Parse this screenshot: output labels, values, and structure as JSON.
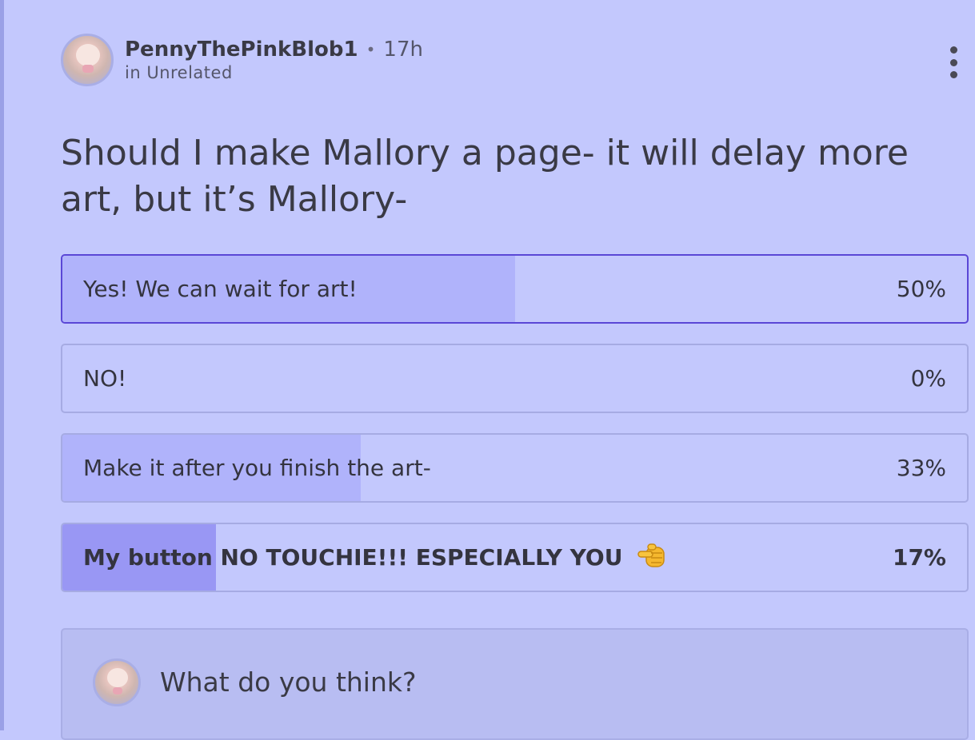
{
  "post": {
    "author": "PennyThePinkBlob1",
    "separator": "•",
    "time": "17h",
    "category": "in Unrelated",
    "title": "Should I make Mallory a page- it will delay more art, but it’s Mallory-"
  },
  "poll": {
    "options": [
      {
        "label": "Yes! We can wait for art!",
        "percent_label": "50%",
        "percent": 50
      },
      {
        "label": "NO!",
        "percent_label": "0%",
        "percent": 0
      },
      {
        "label": "Make it after you finish the art-",
        "percent_label": "33%",
        "percent": 33
      },
      {
        "label": "My button NO TOUCHIE!!! ESPECIALLY YOU",
        "percent_label": "17%",
        "percent": 17
      }
    ]
  },
  "comment": {
    "placeholder": "What do you think?"
  },
  "icons": {
    "more": "more-vertical-icon",
    "pointing": "pointing-fist-emoji-icon"
  },
  "colors": {
    "background": "#c3c8fd",
    "selected_border": "#5a47d6",
    "fill": "#b0b3fb",
    "winner_fill": "#9997f4"
  }
}
